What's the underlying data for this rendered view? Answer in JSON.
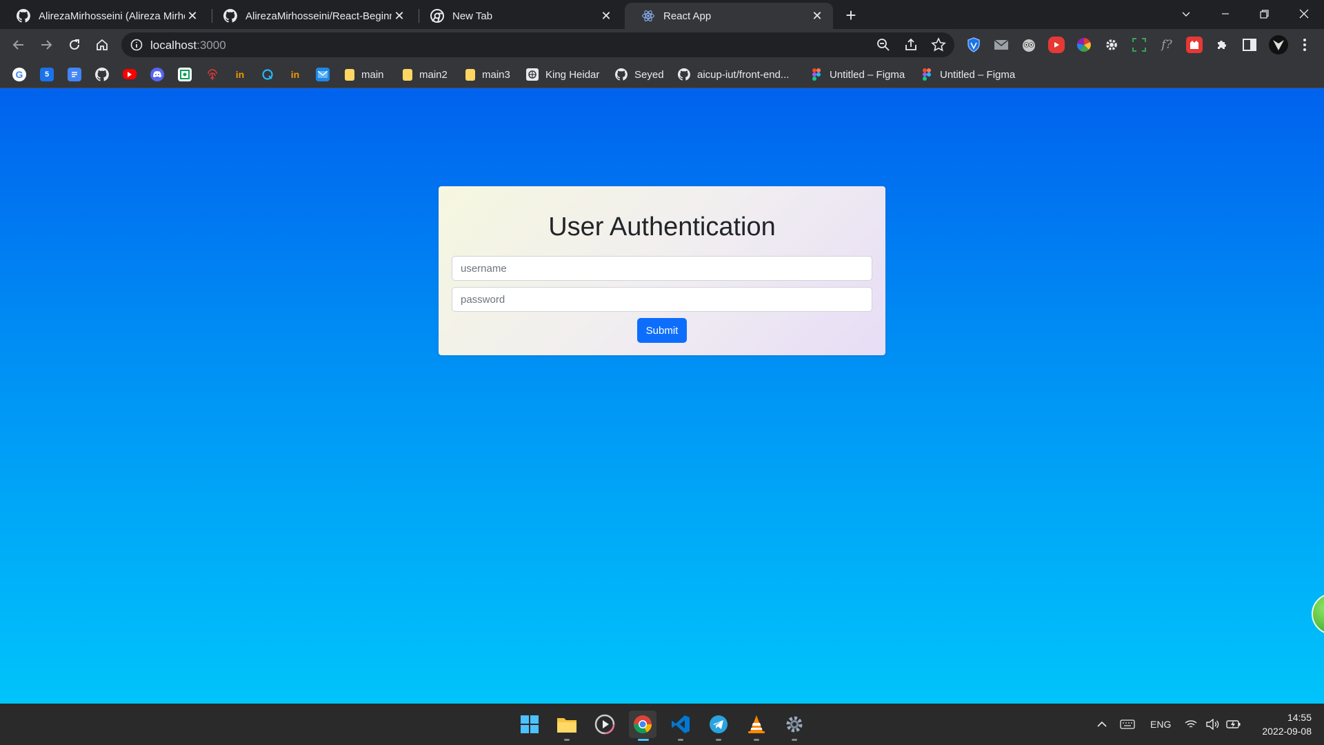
{
  "browser": {
    "tabs": [
      {
        "title": "AlirezaMirhosseini (Alireza Mirhosseini)",
        "favicon": "github-icon",
        "active": false
      },
      {
        "title": "AlirezaMirhosseini/React-Beginner",
        "favicon": "github-icon",
        "active": false
      },
      {
        "title": "New Tab",
        "favicon": "chrome-icon",
        "active": false
      },
      {
        "title": "React App",
        "favicon": "react-icon",
        "active": true
      }
    ],
    "new_tab_label": "+",
    "close_glyph": "✕",
    "url_host": "localhost",
    "url_port": ":3000"
  },
  "bookmarks": [
    {
      "label": "main",
      "icon": "folder-icon"
    },
    {
      "label": "main2",
      "icon": "folder-icon"
    },
    {
      "label": "main3",
      "icon": "folder-icon"
    },
    {
      "label": "King Heidar",
      "icon": "site-icon"
    },
    {
      "label": "Seyed",
      "icon": "github-icon"
    },
    {
      "label": "aicup-iut/front-end...",
      "icon": "github-icon"
    },
    {
      "label": "Untitled – Figma",
      "icon": "figma-icon"
    },
    {
      "label": "Untitled – Figma",
      "icon": "figma-icon"
    }
  ],
  "auth": {
    "title": "User Authentication",
    "username_placeholder": "username",
    "password_placeholder": "password",
    "submit_label": "Submit"
  },
  "taskbar": {
    "language": "ENG",
    "time": "14:55",
    "date": "2022-09-08"
  },
  "colors": {
    "accent": "#0d6efd",
    "page_gradient_top": "#0062ee",
    "page_gradient_bottom": "#00c4fb"
  }
}
